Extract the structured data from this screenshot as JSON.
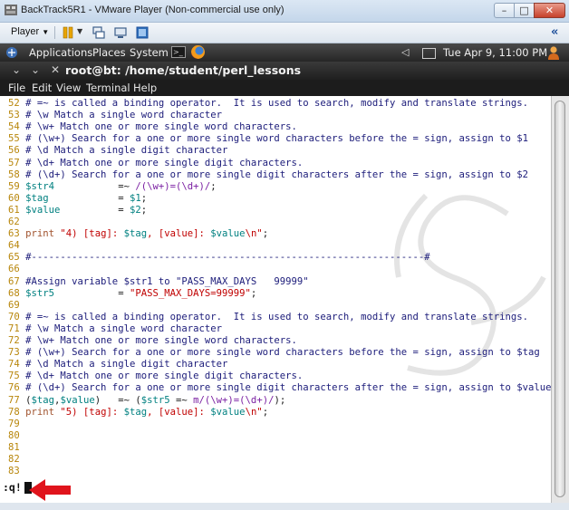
{
  "vmware": {
    "window_title": "BackTrack5R1 - VMware Player (Non-commercial use only)",
    "player_menu": "Player",
    "min_label": "–",
    "max_label": "□",
    "close_label": "✕",
    "collapse_label": "«"
  },
  "gnome_panel": {
    "applications": "Applications",
    "places": "Places",
    "system": "System",
    "clock": "Tue Apr  9, 11:00 PM"
  },
  "terminal": {
    "title": "root@bt: /home/student/perl_lessons",
    "menu": [
      "File",
      "Edit",
      "View",
      "Terminal",
      "Help"
    ],
    "lines": [
      {
        "n": "52",
        "parts": [
          [
            "cm",
            "# =~ is called a binding operator.  It is used to search, modify and translate strings."
          ]
        ]
      },
      {
        "n": "53",
        "parts": [
          [
            "cm",
            "# \\w Match a single word character"
          ]
        ]
      },
      {
        "n": "54",
        "parts": [
          [
            "cm",
            "# \\w+ Match one or more single word characters."
          ]
        ]
      },
      {
        "n": "55",
        "parts": [
          [
            "cm",
            "# (\\w+) Search for a one or more single word characters before the = sign, assign to $1"
          ]
        ]
      },
      {
        "n": "56",
        "parts": [
          [
            "cm",
            "# \\d Match a single digit character"
          ]
        ]
      },
      {
        "n": "57",
        "parts": [
          [
            "cm",
            "# \\d+ Match one or more single digit characters."
          ]
        ]
      },
      {
        "n": "58",
        "parts": [
          [
            "cm",
            "# (\\d+) Search for a one or more single digit characters after the = sign, assign to $2"
          ]
        ]
      },
      {
        "n": "59",
        "parts": [
          [
            "var",
            "$str4"
          ],
          [
            "op",
            "           =~ "
          ],
          [
            "rx",
            "/(\\w+)=(\\d+)/"
          ],
          [
            "op",
            ";"
          ]
        ]
      },
      {
        "n": "60",
        "parts": [
          [
            "var",
            "$tag"
          ],
          [
            "op",
            "            = "
          ],
          [
            "var",
            "$1"
          ],
          [
            "op",
            ";"
          ]
        ]
      },
      {
        "n": "61",
        "parts": [
          [
            "var",
            "$value"
          ],
          [
            "op",
            "          = "
          ],
          [
            "var",
            "$2"
          ],
          [
            "op",
            ";"
          ]
        ]
      },
      {
        "n": "62",
        "parts": []
      },
      {
        "n": "63",
        "parts": [
          [
            "kw",
            "print "
          ],
          [
            "str",
            "\"4) [tag]: "
          ],
          [
            "var",
            "$tag"
          ],
          [
            "str",
            ", [value]: "
          ],
          [
            "var",
            "$value"
          ],
          [
            "str",
            "\\n\""
          ],
          [
            "op",
            ";"
          ]
        ]
      },
      {
        "n": "64",
        "parts": []
      },
      {
        "n": "65",
        "parts": [
          [
            "cm",
            "#--------------------------------------------------------------------#"
          ]
        ]
      },
      {
        "n": "66",
        "parts": []
      },
      {
        "n": "67",
        "parts": [
          [
            "cm",
            "#Assign variable $str1 to \"PASS_MAX_DAYS   99999\""
          ]
        ]
      },
      {
        "n": "68",
        "parts": [
          [
            "var",
            "$str5"
          ],
          [
            "op",
            "           = "
          ],
          [
            "str",
            "\"PASS_MAX_DAYS=99999\""
          ],
          [
            "op",
            ";"
          ]
        ]
      },
      {
        "n": "69",
        "parts": []
      },
      {
        "n": "70",
        "parts": [
          [
            "cm",
            "# =~ is called a binding operator.  It is used to search, modify and translate strings."
          ]
        ]
      },
      {
        "n": "71",
        "parts": [
          [
            "cm",
            "# \\w Match a single word character"
          ]
        ]
      },
      {
        "n": "72",
        "parts": [
          [
            "cm",
            "# \\w+ Match one or more single word characters."
          ]
        ]
      },
      {
        "n": "73",
        "parts": [
          [
            "cm",
            "# (\\w+) Search for a one or more single word characters before the = sign, assign to $tag"
          ]
        ]
      },
      {
        "n": "74",
        "parts": [
          [
            "cm",
            "# \\d Match a single digit character"
          ]
        ]
      },
      {
        "n": "75",
        "parts": [
          [
            "cm",
            "# \\d+ Match one or more single digit characters."
          ]
        ]
      },
      {
        "n": "76",
        "parts": [
          [
            "cm",
            "# (\\d+) Search for a one or more single digit characters after the = sign, assign to $value"
          ]
        ]
      },
      {
        "n": "77",
        "parts": [
          [
            "op",
            "("
          ],
          [
            "var",
            "$tag"
          ],
          [
            "op",
            ","
          ],
          [
            "var",
            "$value"
          ],
          [
            "op",
            ")   =~ ("
          ],
          [
            "var",
            "$str5"
          ],
          [
            "op",
            " =~ "
          ],
          [
            "rx",
            "m/(\\w+)=(\\d+)/"
          ],
          [
            "op",
            ");"
          ]
        ]
      },
      {
        "n": "78",
        "parts": [
          [
            "kw",
            "print "
          ],
          [
            "str",
            "\"5) [tag]: "
          ],
          [
            "var",
            "$tag"
          ],
          [
            "str",
            ", [value]: "
          ],
          [
            "var",
            "$value"
          ],
          [
            "str",
            "\\n\""
          ],
          [
            "op",
            ";"
          ]
        ]
      },
      {
        "n": "79",
        "parts": []
      },
      {
        "n": "80",
        "parts": []
      },
      {
        "n": "81",
        "parts": []
      },
      {
        "n": "82",
        "parts": []
      },
      {
        "n": "83",
        "parts": []
      }
    ],
    "status_command": ":q!"
  },
  "colors": {
    "line_number": "#b8860b",
    "comment": "#1c1c7a",
    "variable": "#008080",
    "string": "#c00000",
    "arrow": "#e0141c"
  },
  "icons": [
    "vmware-logo-icon",
    "pause-icon",
    "send-ctrl-alt-del-icon",
    "removable-devices-icon",
    "fullscreen-icon",
    "terminal-launcher-icon",
    "firefox-icon",
    "speaker-icon",
    "mail-icon",
    "user-icon",
    "red-arrow-icon"
  ]
}
